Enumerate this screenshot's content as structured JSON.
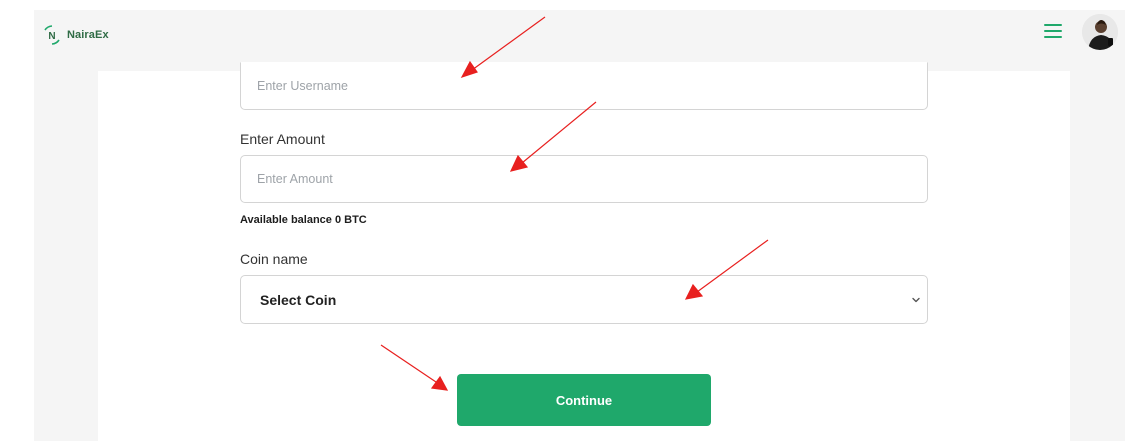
{
  "brand": {
    "name": "NairaEx",
    "mark": "N",
    "color": "#2f6b45"
  },
  "header": {
    "menu_icon": "hamburger-menu-icon",
    "avatar_icon": "user-avatar"
  },
  "form": {
    "username": {
      "placeholder": "Enter Username",
      "value": ""
    },
    "amount": {
      "label": "Enter Amount",
      "placeholder": "Enter Amount",
      "value": ""
    },
    "balance_text": "Available balance 0 BTC",
    "coin": {
      "label": "Coin name",
      "selected": "Select Coin"
    },
    "continue_label": "Continue"
  },
  "colors": {
    "accent": "#1fa86b",
    "annotation_arrow": "#e8201f",
    "page_bg": "#f5f5f5"
  }
}
